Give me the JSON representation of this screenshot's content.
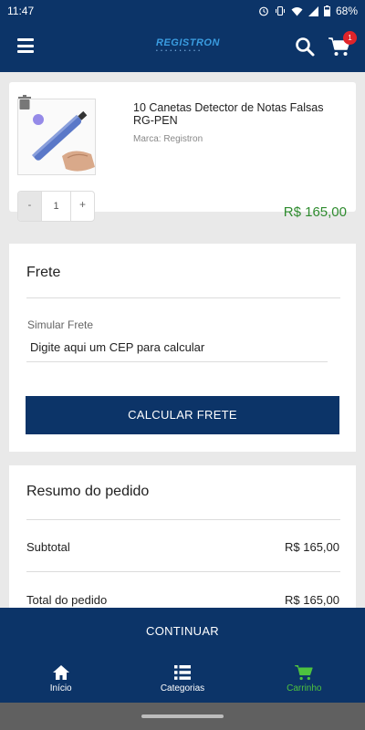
{
  "status_bar": {
    "time": "11:47",
    "battery": "68%",
    "icons": [
      "alarm-icon",
      "vibrate-icon",
      "wifi-icon",
      "signal-icon",
      "battery-icon"
    ]
  },
  "header": {
    "logo_text": "REGISTRON",
    "cart_count": "1",
    "icons": [
      "menu-icon",
      "search-icon",
      "cart-icon"
    ]
  },
  "product": {
    "title": "10 Canetas Detector de Notas Falsas RG-PEN",
    "brand": "Marca: Registron",
    "quantity": "1",
    "minus_label": "-",
    "plus_label": "+",
    "price": "R$ 165,00"
  },
  "freight": {
    "title": "Frete",
    "simulate_label": "Simular Frete",
    "cep_placeholder": "Digite aqui um CEP para calcular",
    "calc_button": "CALCULAR FRETE"
  },
  "summary": {
    "title": "Resumo do pedido",
    "subtotal_label": "Subtotal",
    "subtotal_value": "R$ 165,00",
    "total_label": "Total do pedido",
    "total_value": "R$ 165,00"
  },
  "continue_button": "CONTINUAR",
  "bottom_nav": {
    "items": [
      {
        "label": "Início",
        "icon": "home-icon"
      },
      {
        "label": "Categorias",
        "icon": "list-icon"
      },
      {
        "label": "Carrinho",
        "icon": "cart-icon"
      }
    ],
    "active": "Carrinho"
  },
  "colors": {
    "primary": "#0c3468",
    "price_green": "#2e8b2e",
    "active_nav": "#4ec23e",
    "badge": "#e0242a"
  }
}
